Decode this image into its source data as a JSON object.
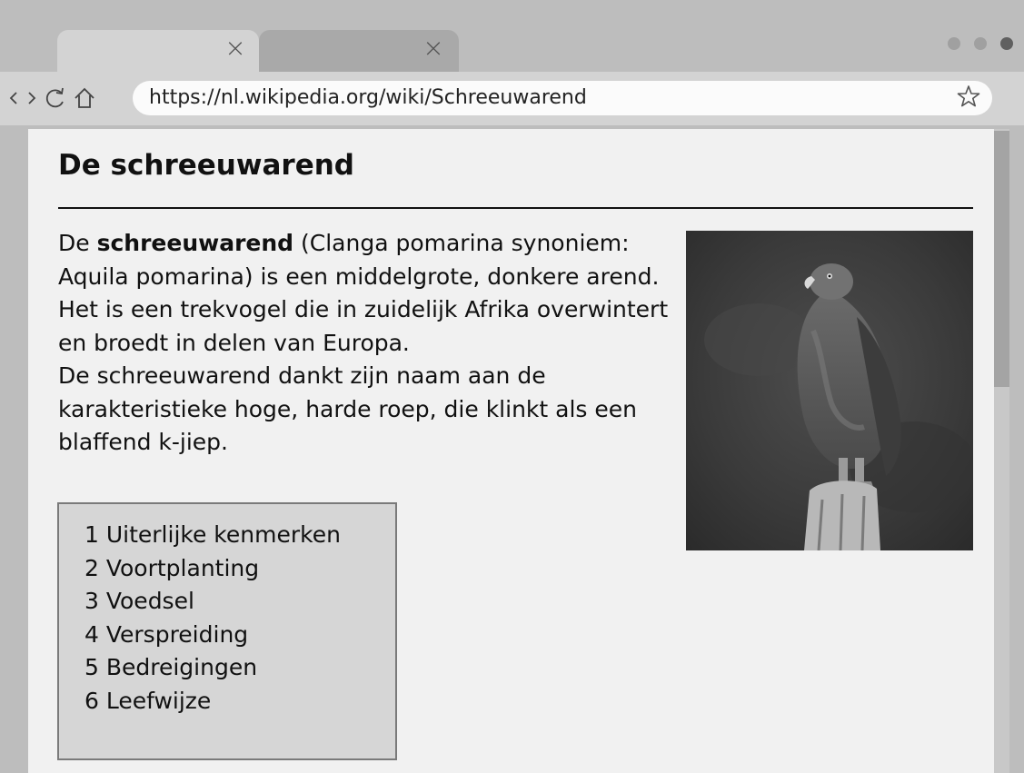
{
  "browser": {
    "tabs": [
      {
        "label": "",
        "active": true
      },
      {
        "label": "",
        "active": false
      }
    ],
    "tab_close_glyph": "×",
    "window_dot_colors": [
      "#a0a0a0",
      "#a0a0a0",
      "#606060"
    ],
    "address_bar": {
      "url": "https://nl.wikipedia.org/wiki/Schreeuwarend"
    },
    "icons": {
      "back": "chevron-left-icon",
      "forward": "chevron-right-icon",
      "reload": "reload-icon",
      "home": "home-icon",
      "bookmark": "star-icon"
    }
  },
  "article": {
    "title": "De schreeuwarend",
    "intro_prefix": "De ",
    "intro_bold": "schreeuwarend",
    "intro_rest": " (Clanga pomarina synoniem: Aquila pomarina) is een middelgrote, donkere arend. Het is een trekvogel die in zuidelijk Afrika overwintert en broedt in delen van Europa.",
    "intro_second": "De schreeuwarend dankt zijn naam aan de karakteristieke hoge, harde roep, die klinkt als een blaffend k-jiep.",
    "toc": [
      "1 Uiterlijke kenmerken",
      "2 Voortplanting",
      "3 Voedsel",
      "4 Verspreiding",
      "5 Bedreigingen",
      "6 Leefwijze"
    ]
  },
  "colors": {
    "chrome": "#bdbdbd",
    "toolbar": "#d3d3d3",
    "page": "#f1f1f1",
    "toc_background": "#d6d6d6"
  }
}
